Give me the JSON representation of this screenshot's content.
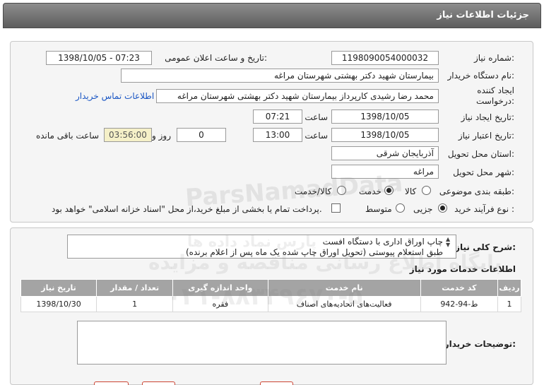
{
  "window": {
    "title": "جزئیات اطلاعات نیاز"
  },
  "fields": {
    "need_number_label": "شماره نیاز:",
    "need_number": "1198090054000032",
    "announce_label": "تاریخ و ساعت اعلان عمومی:",
    "announce_value": "1398/10/05 - 07:23",
    "buyer_org_label": "نام دستگاه خریدار:",
    "buyer_org": "بیمارستان شهید دکتر بهشتی شهرستان مراغه",
    "creator_label_1": "ایجاد کننده",
    "creator_label_2": "درخواست:",
    "creator": "محمد رضا رشیدی کارپرداز بیمارستان شهید دکتر بهشتی شهرستان مراغه",
    "buyer_contact_link": "اطلاعات تماس خریدار",
    "create_date_label": "تاریخ ایجاد نیاز:",
    "create_date": "1398/10/05",
    "time_label": "ساعت",
    "create_time": "07:21",
    "valid_date_label": "تاریخ اعتبار نیاز:",
    "valid_date": "1398/10/05",
    "valid_time": "13:00",
    "days_label": "روز و",
    "days": "0",
    "remaining_time": "03:56:00",
    "remaining_label": "ساعت باقی مانده",
    "province_label": "استان محل تحویل:",
    "province": "آذربایجان شرقی",
    "city_label": "شهر محل تحویل:",
    "city": "مراغه",
    "category_label": "طبقه بندی موضوعی:",
    "category_options": [
      "کالا",
      "خدمت",
      "کالا/خدمت"
    ],
    "category_selected": "خدمت",
    "process_label": "نوع فرآیند خرید :",
    "process_options": [
      "جزیی",
      "متوسط"
    ],
    "process_selected": "جزیی",
    "payment_note": "پرداخت تمام یا بخشی از مبلغ خرید،از محل \"اسناد خزانه اسلامی\" خواهد بود."
  },
  "details": {
    "general_desc_label": "شرح کلی نیاز:",
    "general_desc_line1": "چاپ اوراق اداری  با دستگاه افست",
    "general_desc_line2": "طبق استعلام پیوستی (تحویل اوراق چاپ شده یک ماه پس از اعلام برنده)",
    "services_title": "اطلاعات خدمات مورد نیاز",
    "table_headers": [
      "ردیف",
      "کد خدمت",
      "نام خدمت",
      "واحد اندازه گیری",
      "تعداد / مقدار",
      "تاریخ نیاز"
    ],
    "table_rows": [
      [
        "1",
        "ط-94-942",
        "فعالیت‌های اتحادیه‌های اصناف",
        "فقره",
        "1",
        "1398/10/30"
      ]
    ],
    "buyer_notes_label": "توضیحات خریدار:"
  },
  "watermark": {
    "brand": "ParsNamadData",
    "text1": "پایگاه اطلاع رسانی مناقصه و مزایده",
    "text2": "۰۲۱-۸۸۳۴۹۶۷۰-۵",
    "text3": "پارس نماد داده ها"
  }
}
